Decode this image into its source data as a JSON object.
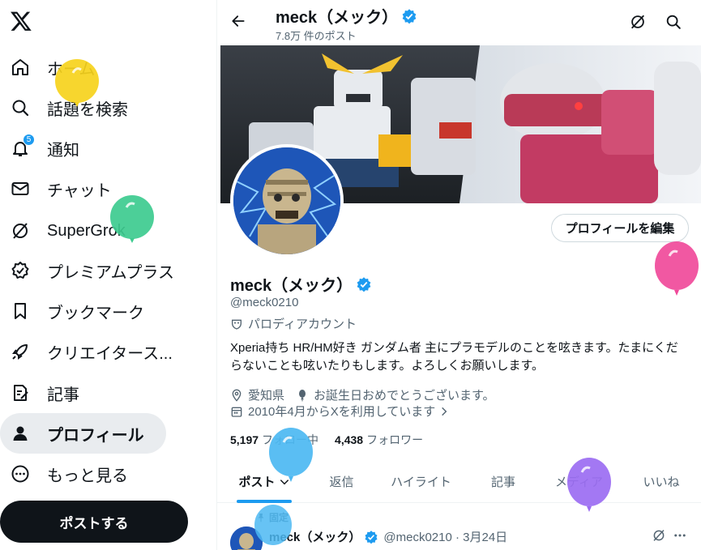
{
  "sidebar": {
    "logo": "x-logo",
    "items": [
      {
        "label": "ホーム",
        "icon": "home-icon"
      },
      {
        "label": "話題を検索",
        "icon": "search-icon"
      },
      {
        "label": "通知",
        "icon": "bell-icon",
        "badge": "5"
      },
      {
        "label": "チャット",
        "icon": "mail-icon"
      },
      {
        "label": "SuperGrok",
        "icon": "grok-icon"
      },
      {
        "label": "プレミアムプラス",
        "icon": "verified-badge-icon"
      },
      {
        "label": "ブックマーク",
        "icon": "bookmark-icon"
      },
      {
        "label": "クリエイタース...",
        "icon": "rocket-icon"
      },
      {
        "label": "記事",
        "icon": "article-icon"
      },
      {
        "label": "プロフィール",
        "icon": "person-icon"
      },
      {
        "label": "もっと見る",
        "icon": "more-circle-icon"
      }
    ],
    "post_button": "ポストする"
  },
  "header": {
    "name": "meck（メック）",
    "post_count": "7.8万 件のポスト"
  },
  "profile": {
    "edit_button": "プロフィールを編集",
    "name": "meck（メック）",
    "handle": "@meck0210",
    "parody_label": "パロディアカウント",
    "bio": "Xperia持ち HR/HM好き ガンダム者 主にプラモデルのことを呟きます。たまにくだらないことも呟いたりもします。よろしくお願いします。",
    "location": "愛知県",
    "birthday": "お誕生日おめでとうございます。",
    "joined": "2010年4月からXを利用しています",
    "following_count": "5,197",
    "following_label": "フォロー中",
    "followers_count": "4,438",
    "followers_label": "フォロワー"
  },
  "tabs": [
    "ポスト",
    "返信",
    "ハイライト",
    "記事",
    "メディア",
    "いいね"
  ],
  "pinned": {
    "label": "固定",
    "name": "meck（メック）",
    "handle_date": "@meck0210 · 3月24日"
  },
  "colors": {
    "accent": "#1d9bf0",
    "text": "#0f1419",
    "muted": "#536471"
  }
}
